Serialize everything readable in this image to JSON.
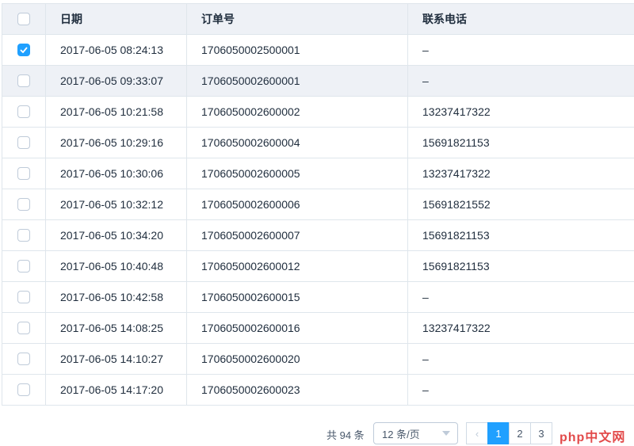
{
  "table": {
    "headers": [
      "日期",
      "订单号",
      "联系电话"
    ],
    "rows": [
      {
        "date": "2017-06-05 08:24:13",
        "order": "1706050002500001",
        "phone": "–",
        "checked": true
      },
      {
        "date": "2017-06-05 09:33:07",
        "order": "1706050002600001",
        "phone": "–",
        "checked": false
      },
      {
        "date": "2017-06-05 10:21:58",
        "order": "1706050002600002",
        "phone": "13237417322",
        "checked": false
      },
      {
        "date": "2017-06-05 10:29:16",
        "order": "1706050002600004",
        "phone": "15691821153",
        "checked": false
      },
      {
        "date": "2017-06-05 10:30:06",
        "order": "1706050002600005",
        "phone": "13237417322",
        "checked": false
      },
      {
        "date": "2017-06-05 10:32:12",
        "order": "1706050002600006",
        "phone": "15691821552",
        "checked": false
      },
      {
        "date": "2017-06-05 10:34:20",
        "order": "1706050002600007",
        "phone": "15691821153",
        "checked": false
      },
      {
        "date": "2017-06-05 10:40:48",
        "order": "1706050002600012",
        "phone": "15691821153",
        "checked": false
      },
      {
        "date": "2017-06-05 10:42:58",
        "order": "1706050002600015",
        "phone": "–",
        "checked": false
      },
      {
        "date": "2017-06-05 14:08:25",
        "order": "1706050002600016",
        "phone": "13237417322",
        "checked": false
      },
      {
        "date": "2017-06-05 14:10:27",
        "order": "1706050002600020",
        "phone": "–",
        "checked": false
      },
      {
        "date": "2017-06-05 14:17:20",
        "order": "1706050002600023",
        "phone": "–",
        "checked": false
      }
    ]
  },
  "pagination": {
    "total_label": "共 94 条",
    "page_size_label": "12 条/页",
    "pages": [
      "1",
      "2",
      "3"
    ],
    "current_page": "1"
  },
  "watermark": "php中文网",
  "colors": {
    "accent": "#20a0ff",
    "border": "#dfe6ec",
    "header_bg": "#eef1f6"
  }
}
